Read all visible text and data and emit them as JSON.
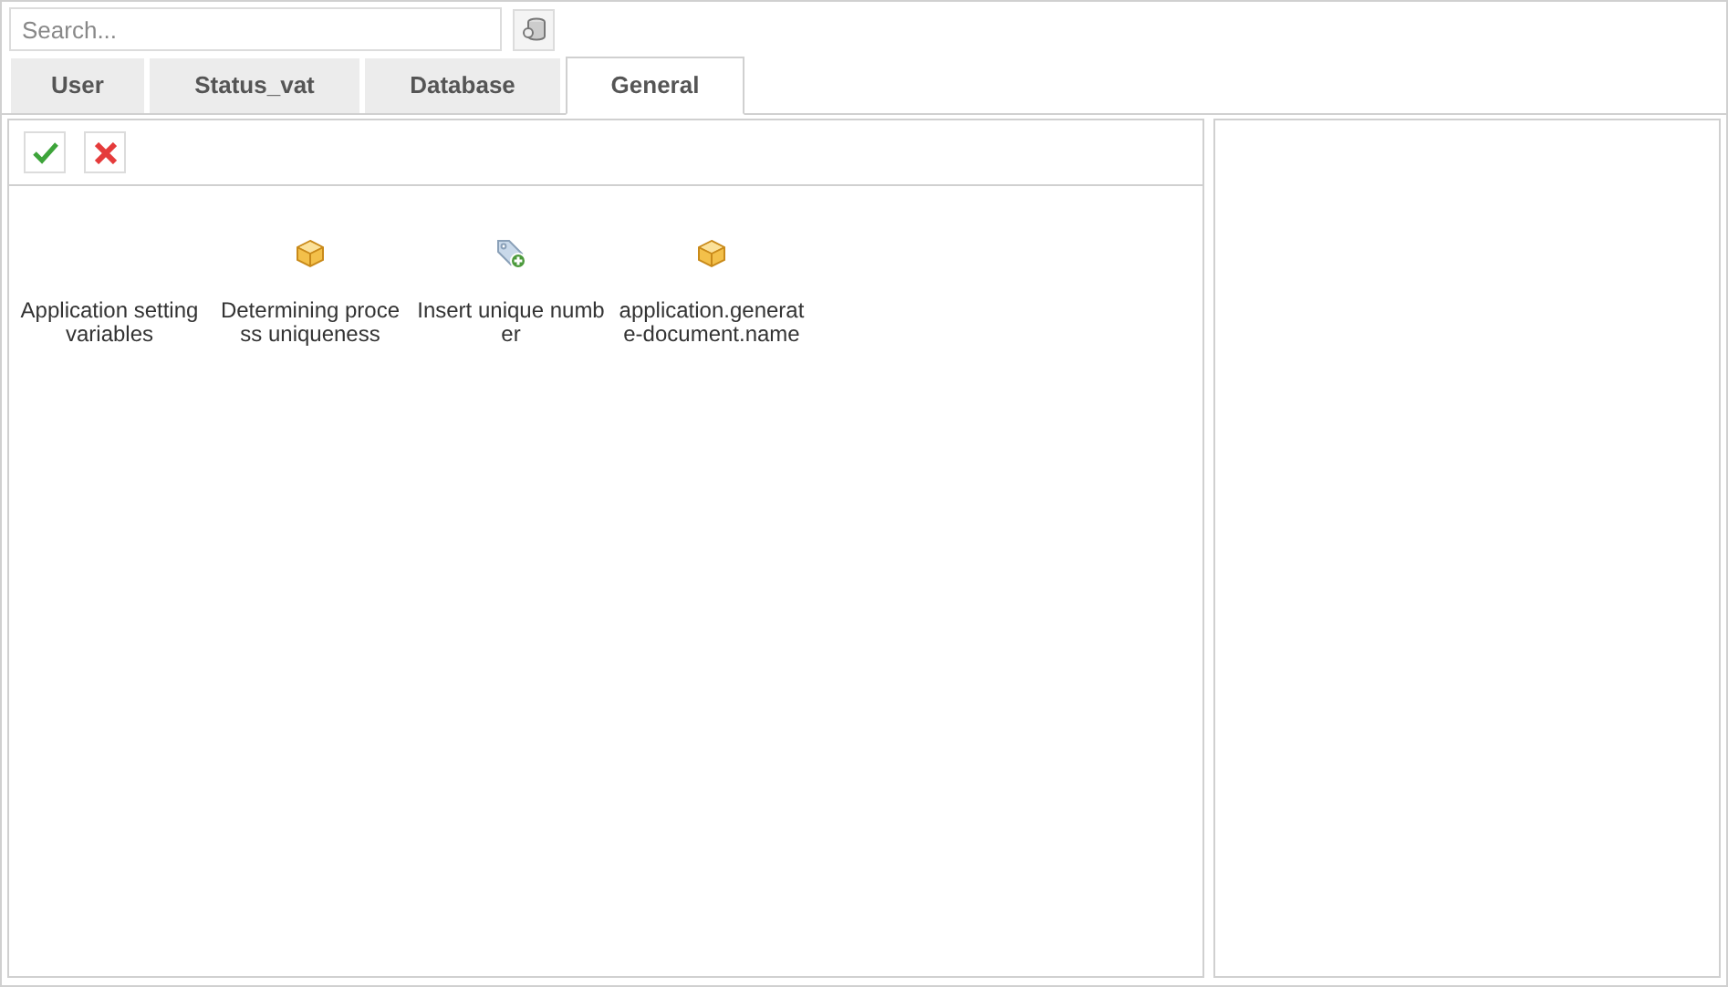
{
  "search": {
    "placeholder": "Search..."
  },
  "tabs": [
    {
      "label": "User",
      "selected": false
    },
    {
      "label": "Status_vat",
      "selected": false
    },
    {
      "label": "Database",
      "selected": false
    },
    {
      "label": "General",
      "selected": true
    }
  ],
  "items": [
    {
      "kind": "plain",
      "label": "Application setting variables"
    },
    {
      "kind": "box",
      "label": "Determining process uniqueness"
    },
    {
      "kind": "tag",
      "label": "Insert unique number"
    },
    {
      "kind": "box",
      "label": "application.generate-document.name"
    }
  ]
}
